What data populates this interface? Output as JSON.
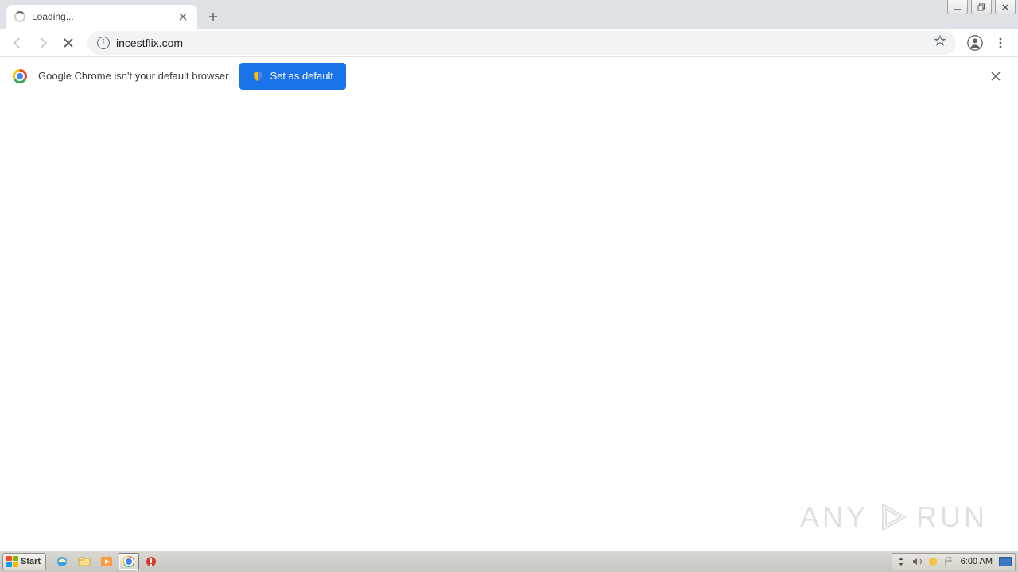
{
  "window": {
    "min_tip": "Minimize",
    "max_tip": "Maximize",
    "close_tip": "Close"
  },
  "tab": {
    "title": "Loading...",
    "close_tip": "Close tab",
    "new_tip": "New tab"
  },
  "toolbar": {
    "url": "incestflix.com"
  },
  "infobar": {
    "message": "Google Chrome isn't your default browser",
    "button": "Set as default"
  },
  "watermark": {
    "left": "ANY",
    "right": "RUN"
  },
  "taskbar": {
    "start": "Start",
    "clock": "6:00 AM"
  }
}
